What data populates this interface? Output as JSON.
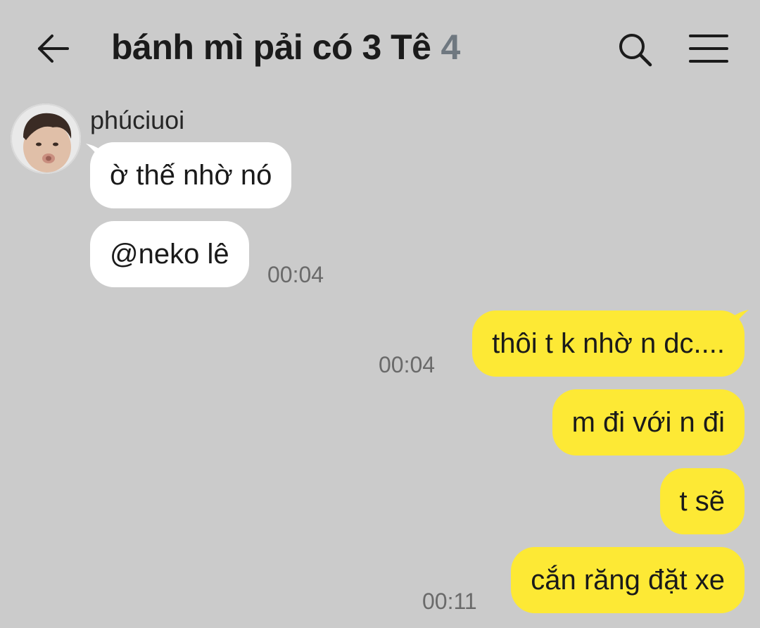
{
  "header": {
    "title": "bánh mì pải có 3 Tê",
    "member_count": "4",
    "back_icon": "arrow-left-icon",
    "search_icon": "search-icon",
    "menu_icon": "hamburger-menu-icon"
  },
  "colors": {
    "background": "#cbcbcb",
    "incoming_bubble": "#ffffff",
    "outgoing_bubble": "#fde935",
    "member_count": "#6f7880",
    "timestamp": "#6a6a6a"
  },
  "incoming": {
    "sender": "phúciuoi",
    "messages": [
      {
        "text": "ờ thế nhờ nó"
      },
      {
        "text": "@neko lê",
        "time": "00:04"
      }
    ]
  },
  "outgoing": {
    "messages": [
      {
        "text": "thôi t k nhờ n dc....",
        "time": "00:04"
      },
      {
        "text": "m đi với n đi"
      },
      {
        "text": "t sẽ"
      },
      {
        "text": "cắn răng đặt xe",
        "time": "00:11"
      }
    ]
  }
}
